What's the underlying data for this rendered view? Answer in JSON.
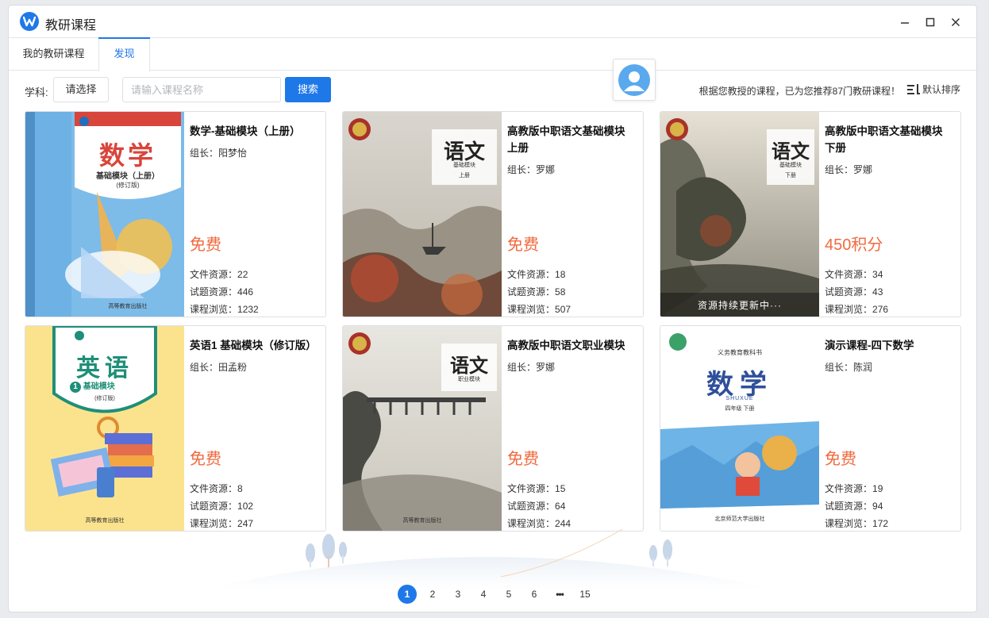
{
  "window": {
    "title": "教研课程"
  },
  "tabs": [
    {
      "label": "我的教研课程"
    },
    {
      "label": "发现"
    }
  ],
  "filter": {
    "subject_label": "学科:",
    "subject_select": "请选择",
    "search_placeholder": "请输入课程名称",
    "search_button": "搜索"
  },
  "recommend_text": "根据您教授的课程，已为您推荐87门教研课程！",
  "sort_label": "默认排序",
  "labels": {
    "files": "文件资源：",
    "questions": "试题资源：",
    "views": "课程浏览："
  },
  "courses": [
    {
      "title": "数学-基础模块（上册）",
      "leader": "组长：阳梦怡",
      "price": "免费",
      "files": "22",
      "questions": "446",
      "views": "1232",
      "cover": {
        "title": "数学",
        "subtitle": "基础模块（上册）",
        "edition": "(修订版)",
        "publisher": "高等教育出版社"
      }
    },
    {
      "title": "高教版中职语文基础模块上册",
      "leader": "组长：罗娜",
      "price": "免费",
      "files": "18",
      "questions": "58",
      "views": "507",
      "cover": {
        "title": "语文",
        "subtitle": "基础模块",
        "volume": "上册"
      }
    },
    {
      "title": "高教版中职语文基础模块下册",
      "leader": "组长：罗娜",
      "price": "450积分",
      "files": "34",
      "questions": "43",
      "views": "276",
      "cover": {
        "title": "语文",
        "subtitle": "基础模块",
        "volume": "下册",
        "caption": "资源持续更新中···"
      }
    },
    {
      "title": "英语1 基础模块（修订版）",
      "leader": "组长：田孟粉",
      "price": "免费",
      "files": "8",
      "questions": "102",
      "views": "247",
      "cover": {
        "title": "英语",
        "subtitle": "基础模块",
        "number": "1",
        "edition": "(修订版)",
        "publisher": "高等教育出版社"
      }
    },
    {
      "title": "高教版中职语文职业模块",
      "leader": "组长：罗娜",
      "price": "免费",
      "files": "15",
      "questions": "64",
      "views": "244",
      "cover": {
        "title": "语文",
        "subtitle": "职业模块",
        "publisher": "高等教育出版社"
      }
    },
    {
      "title": "演示课程-四下数学",
      "leader": "组长：陈润",
      "price": "免费",
      "files": "19",
      "questions": "94",
      "views": "172",
      "cover": {
        "series": "义务教育教科书",
        "title": "数学",
        "pinyin": "SHUXUE",
        "grade": "四年级 下册",
        "publisher": "北京师范大学出版社"
      }
    }
  ],
  "pagination": {
    "pages": [
      "1",
      "2",
      "3",
      "4",
      "5",
      "6",
      "•••",
      "15"
    ],
    "current": "1"
  },
  "colors": {
    "primary": "#1f78e8",
    "price": "#f06a3f"
  }
}
